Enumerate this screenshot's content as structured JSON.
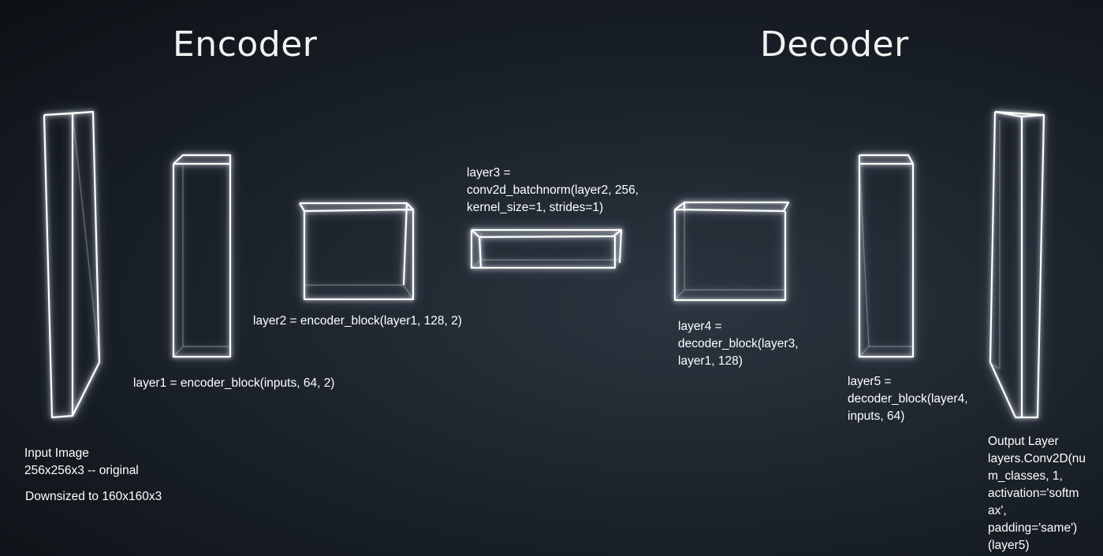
{
  "headings": {
    "encoder": "Encoder",
    "decoder": "Decoder"
  },
  "labels": {
    "input_image": "Input Image\n256x256x3 -- original",
    "downsized": "Downsized to 160x160x3",
    "layer1": "layer1 = encoder_block(inputs, 64, 2)",
    "layer2": "layer2 = encoder_block(layer1, 128, 2)",
    "layer3": "layer3 =\nconv2d_batchnorm(layer2, 256,\nkernel_size=1, strides=1)",
    "layer4": "layer4 =\ndecoder_block(layer3,\nlayer1, 128)",
    "layer5": "layer5 =\ndecoder_block(layer4,\ninputs, 64)",
    "output": "Output Layer\nlayers.Conv2D(nu\nm_classes, 1,\nactivation='softm\nax',\npadding='same')\n(layer5)"
  }
}
